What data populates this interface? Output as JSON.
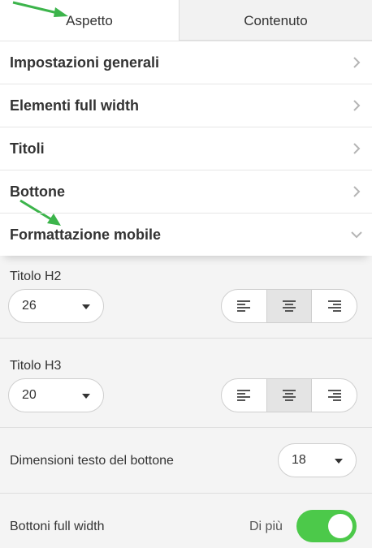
{
  "tabs": [
    {
      "label": "Aspetto",
      "active": true
    },
    {
      "label": "Contenuto",
      "active": false
    }
  ],
  "sections": [
    {
      "title": "Impostazioni generali",
      "icon": "chevron-right-icon"
    },
    {
      "title": "Elementi full width",
      "icon": "chevron-right-icon"
    },
    {
      "title": "Titoli",
      "icon": "chevron-right-icon"
    },
    {
      "title": "Bottone",
      "icon": "chevron-right-icon"
    },
    {
      "title": "Formattazione mobile",
      "icon": "chevron-down-icon",
      "expanded": true
    }
  ],
  "mobile": {
    "h2": {
      "label": "Titolo H2",
      "size": "26",
      "alignment": "center"
    },
    "h3": {
      "label": "Titolo H3",
      "size": "20",
      "alignment": "center"
    },
    "button_text": {
      "label": "Dimensioni testo del bottone",
      "size": "18"
    },
    "full_width": {
      "label": "Bottoni full width",
      "state_text": "Di più",
      "enabled": true
    }
  },
  "colors": {
    "toggle_on": "#4cc94a",
    "annotation_arrow": "#3cb44b"
  }
}
